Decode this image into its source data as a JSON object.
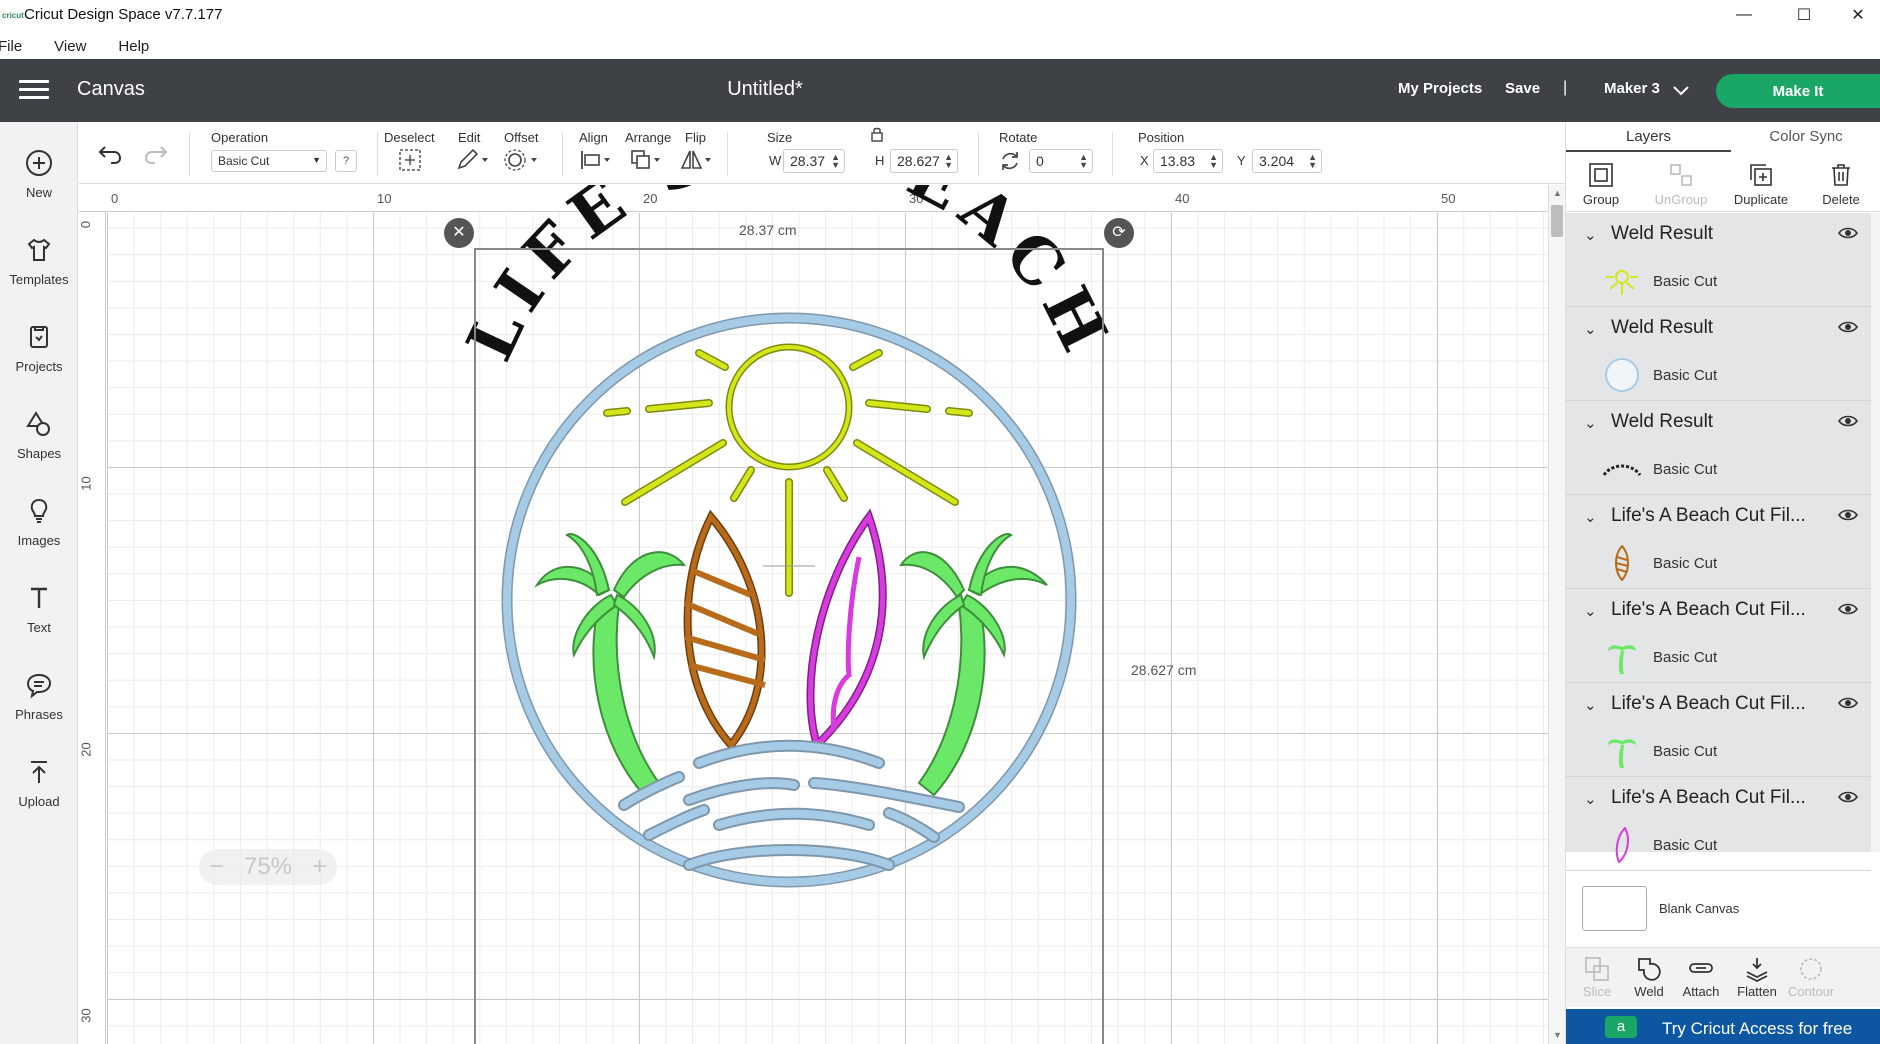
{
  "window": {
    "title": "Cricut Design Space  v7.7.177",
    "logo_text": "cricut",
    "minimize": "—",
    "maximize": "☐",
    "close": "✕"
  },
  "menu": [
    "File",
    "View",
    "Help"
  ],
  "header": {
    "screen_name": "Canvas",
    "doc_title": "Untitled*",
    "my_projects": "My Projects",
    "save": "Save",
    "separator": "|",
    "machine": "Maker 3",
    "make_it": "Make It"
  },
  "left_tools": [
    {
      "label": "New",
      "icon": "plus-circle-icon"
    },
    {
      "label": "Templates",
      "icon": "shirt-icon"
    },
    {
      "label": "Projects",
      "icon": "projects-icon"
    },
    {
      "label": "Shapes",
      "icon": "shapes-icon"
    },
    {
      "label": "Images",
      "icon": "lightbulb-icon"
    },
    {
      "label": "Text",
      "icon": "text-icon"
    },
    {
      "label": "Phrases",
      "icon": "speech-bubble-icon"
    },
    {
      "label": "Upload",
      "icon": "upload-icon"
    }
  ],
  "edit_toolbar": {
    "operation_label": "Operation",
    "operation_value": "Basic Cut",
    "help": "?",
    "deselect": "Deselect",
    "edit": "Edit",
    "offset": "Offset",
    "align": "Align",
    "arrange": "Arrange",
    "flip": "Flip",
    "size": "Size",
    "w_label": "W",
    "w_value": "28.37",
    "h_label": "H",
    "h_value": "28.627",
    "rotate": "Rotate",
    "rotate_value": "0",
    "position": "Position",
    "x_label": "X",
    "x_value": "13.83",
    "y_label": "Y",
    "y_value": "3.204"
  },
  "rulers": {
    "top": [
      "0",
      "10",
      "20",
      "30",
      "40",
      "50"
    ],
    "left": [
      "0",
      "10",
      "20",
      "30"
    ]
  },
  "canvas": {
    "width_label": "28.37 cm",
    "height_label": "28.627 cm",
    "headline": "LIFE'S A BEACH",
    "zoom": "75%",
    "zoom_minus": "−",
    "zoom_plus": "+"
  },
  "right_panel": {
    "tabs": [
      "Layers",
      "Color Sync"
    ],
    "layer_tools": [
      {
        "label": "Group",
        "enabled": true
      },
      {
        "label": "UnGroup",
        "enabled": false
      },
      {
        "label": "Duplicate",
        "enabled": true
      },
      {
        "label": "Delete",
        "enabled": true
      }
    ],
    "layers": [
      {
        "name": "Weld Result",
        "sub": "Basic Cut",
        "thumb": "sun",
        "color": "#d4e61a"
      },
      {
        "name": "Weld Result",
        "sub": "Basic Cut",
        "thumb": "circle",
        "color": "#a6cbe6"
      },
      {
        "name": "Weld Result",
        "sub": "Basic Cut",
        "thumb": "text",
        "color": "#222222"
      },
      {
        "name": "Life's A Beach Cut Fil...",
        "sub": "Basic Cut",
        "thumb": "board",
        "color": "#b86b1a"
      },
      {
        "name": "Life's A Beach Cut Fil...",
        "sub": "Basic Cut",
        "thumb": "palm",
        "color": "#6ce868"
      },
      {
        "name": "Life's A Beach Cut Fil...",
        "sub": "Basic Cut",
        "thumb": "palm",
        "color": "#6ce868"
      },
      {
        "name": "Life's A Beach Cut Fil...",
        "sub": "Basic Cut",
        "thumb": "board",
        "color": "#d93be0"
      }
    ],
    "blank_canvas": "Blank Canvas",
    "bottom_tools": [
      {
        "label": "Slice",
        "enabled": false
      },
      {
        "label": "Weld",
        "enabled": true
      },
      {
        "label": "Attach",
        "enabled": true
      },
      {
        "label": "Flatten",
        "enabled": true
      },
      {
        "label": "Contour",
        "enabled": false
      }
    ],
    "promo": "Try Cricut Access for free",
    "promo_icon": "a"
  },
  "colors": {
    "header_bg": "#3e4146",
    "make_it": "#1aa765",
    "sun": "#d4e61a",
    "ring": "#a6cbe6",
    "palm": "#6ce868",
    "board_orange": "#b86b1a",
    "board_pink": "#d93be0",
    "promo_bg": "#0c56a2"
  }
}
